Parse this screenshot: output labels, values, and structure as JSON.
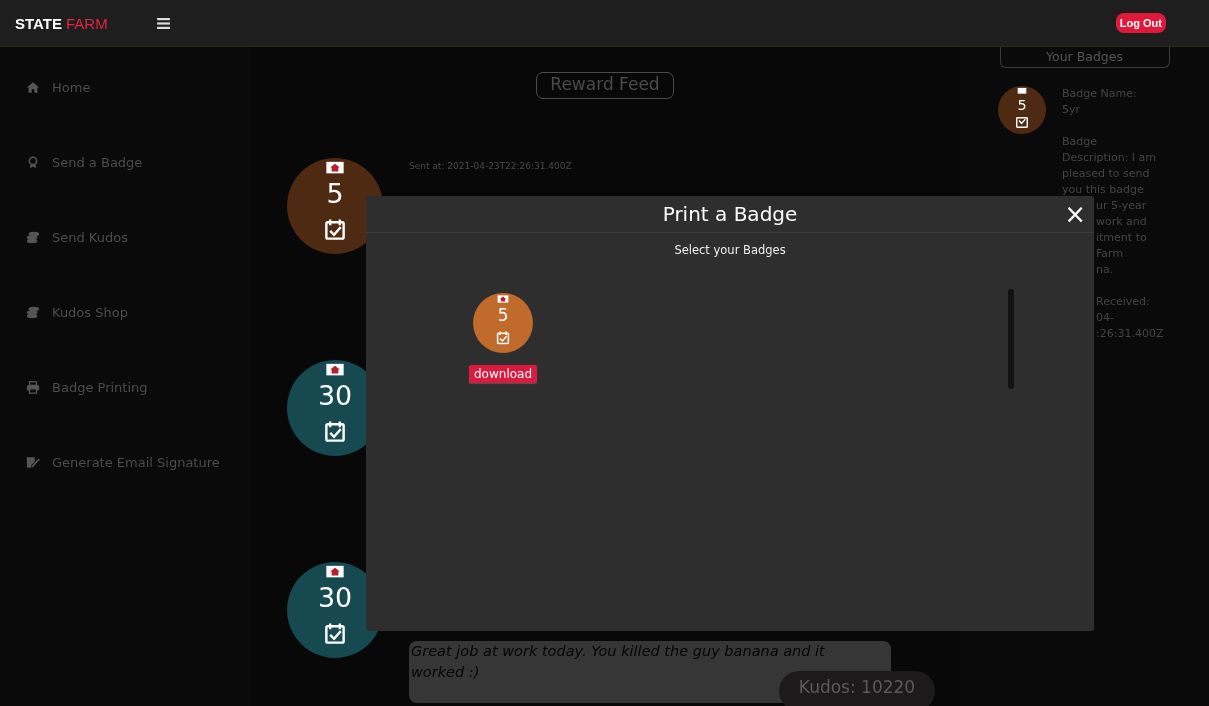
{
  "header": {
    "logo_primary": "STATE",
    "logo_accent": "FARM",
    "logout_button": "Log Out"
  },
  "sidebar": {
    "items": [
      {
        "label": "Home",
        "kind": "home"
      },
      {
        "label": "Send a Badge",
        "kind": "award"
      },
      {
        "label": "Send Kudos",
        "kind": "coins"
      },
      {
        "label": "Kudos Shop",
        "kind": "coins"
      },
      {
        "label": "Badge Printing",
        "kind": "print"
      },
      {
        "label": "Generate Email Signature",
        "kind": "signature"
      }
    ]
  },
  "feed": {
    "title": "Reward Feed",
    "posts": [
      {
        "badge": {
          "number": "5",
          "color": "#4d2a11"
        },
        "sent_at": "Sent at: 2021-04-23T22:26:31.400Z"
      },
      {
        "badge": {
          "number": "30",
          "color": "#174a50"
        }
      },
      {
        "badge": {
          "number": "30",
          "color": "#174a50"
        },
        "message": "Great job at work today. You killed the guy banana and it worked :)"
      }
    ]
  },
  "kudos": "Kudos: 10220",
  "your_badges": {
    "title": "Your Badges",
    "badge": {
      "number": "5",
      "color": "#4d2a11"
    },
    "groups": [
      {
        "lines": [
          "Badge Name:",
          "5yr"
        ]
      },
      {
        "lines": [
          "Badge",
          "Description: I am",
          "pleased to send",
          "you this badge"
        ],
        "partly_hidden_lines": [
          "ur 5-year",
          "work and",
          "itment to",
          "Farm",
          "na."
        ]
      },
      {
        "partly_hidden_lines": [
          "Received:",
          "04-",
          ":26:31.400Z"
        ]
      }
    ]
  },
  "modal": {
    "title": "Print a Badge",
    "close": "×",
    "subtitle": "Select your Badges",
    "badges": [
      {
        "number": "5",
        "color": "#c06a2b",
        "button": "download"
      }
    ]
  }
}
